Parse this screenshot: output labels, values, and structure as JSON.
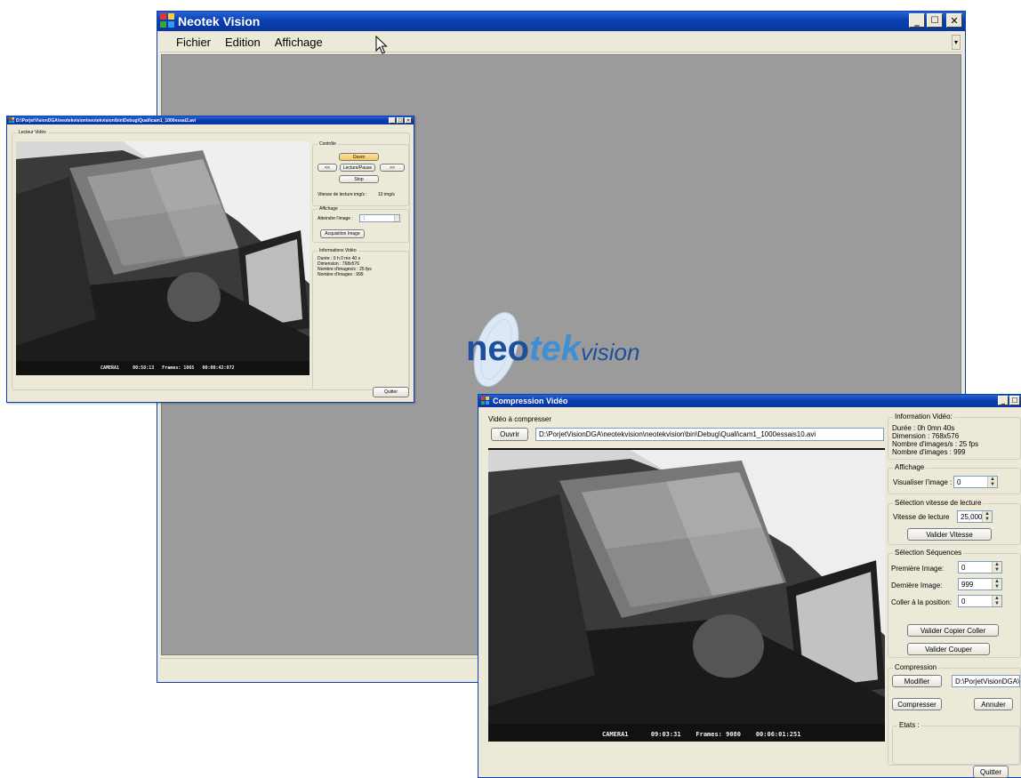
{
  "main_window": {
    "title": "Neotek Vision",
    "menu": [
      {
        "label": "Fichier"
      },
      {
        "label": "Edition"
      },
      {
        "label": "Affichage"
      }
    ],
    "menu_overflow_glyph": "▾"
  },
  "player_window": {
    "title": "D:\\PorjetVisionDGA\\neotekvision\\neotekvision\\bin\\Debug\\Quali\\cam1_1000essai2.avi",
    "video_label": "Lecteur Vidéo",
    "controle": {
      "title": "Contrôle",
      "open_label": "Ouvrir",
      "prev_label": "<<",
      "play_label": "Lecture/Pause",
      "next_label": ">>",
      "stop_label": "Stop",
      "speed_label": "Vitesse de lecture img/s :",
      "speed_value": "10 img/s"
    },
    "affichage": {
      "title": "Affichage",
      "goto_label": "Atteindre l'image :",
      "goto_value": "1",
      "acquire_label": "Acquisition Image"
    },
    "info": {
      "title": "Informations Vidéo",
      "lines": [
        "Durée : 0 h 0 mn 40 s",
        "Dimension : 768x576",
        "Nombre d'images/s : 25 fps",
        "Nombre d'images : 999"
      ]
    },
    "osd": {
      "camera": "CAMERA1",
      "time": "00:58:13",
      "frames_label": "Frames:",
      "frames_value": "1065",
      "timecode": "00:00:42:972"
    },
    "quit_label": "Quitter"
  },
  "compress_window": {
    "title": "Compression Vidéo",
    "video_label": "Vidéo à compresser",
    "open_label": "Ouvrir",
    "path": "D:\\PorjetVisionDGA\\neotekvision\\neotekvision\\bin\\Debug\\Quali\\cam1_1000essais10.avi",
    "info": {
      "title": "Information Vidéo:",
      "lines": [
        "Durée : 0h 0mn 40s",
        "Dimension : 768x576",
        "Nombre d'images/s : 25 fps",
        "Nombre d'images :  999"
      ]
    },
    "affichage": {
      "title": "Affichage",
      "label": "Visualiser l'image :",
      "value": "0"
    },
    "vitesse": {
      "title": "Sélection vitesse de lecture",
      "label": "Vitesse de lecture",
      "value": "25,0000",
      "button": "Valider Vitesse"
    },
    "sequences": {
      "title": "Sélection Séquences",
      "first_label": "Première Image:",
      "first_value": "0",
      "last_label": "Dernière Image:",
      "last_value": "999",
      "paste_label": "Coller à la position:",
      "paste_value": "0",
      "copy_paste_button": "Valider Copier Coller",
      "cut_button": "Valider Couper"
    },
    "compression": {
      "title": "Compression",
      "modify_label": "Modifier",
      "output_path": "D:\\PorjetVisionDGA\\ne",
      "compress_label": "Compresser",
      "cancel_label": "Annuler"
    },
    "etats_title": "Etats :",
    "osd": {
      "camera": "CAMERA1",
      "time": "09:03:31",
      "frames_label": "Frames:",
      "frames_value": "9080",
      "timecode": "00:06:01:251"
    },
    "quit_label": "Quitter"
  },
  "logo": {
    "part1": "neo",
    "part2": "tek",
    "part3": "vision"
  },
  "colors": {
    "titlebar": "#0a3fb0",
    "mdi_background": "#9b9b9b",
    "window_face": "#ece9d8",
    "logo_dark": "#1d4f9c",
    "logo_light": "#3f8fd4",
    "play_button_highlight": "#f5c65a"
  }
}
